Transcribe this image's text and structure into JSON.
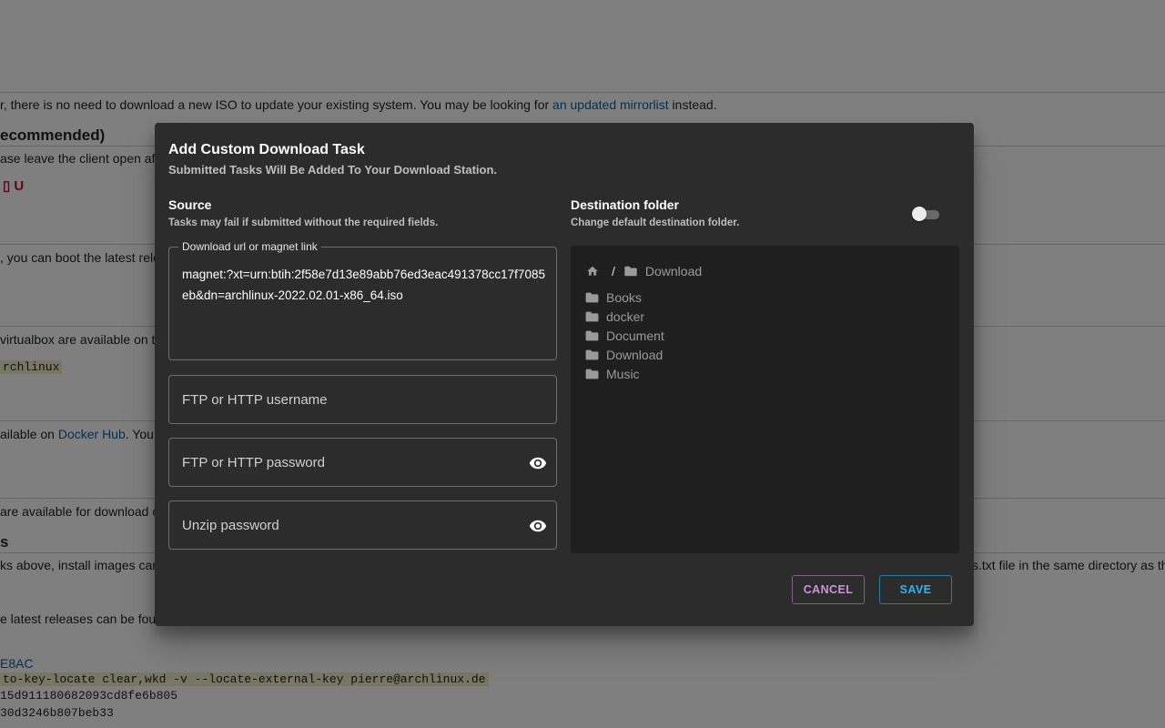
{
  "background": {
    "line1_text": "r, there is no need to download a new ISO to update your existing system. You may be looking for ",
    "line1_link": "an updated mirrorlist",
    "line1_tail": " instead.",
    "heading1": "ecommended)",
    "line2": "ase leave the client open after",
    "line3": ", you can boot the latest relea",
    "line4": "virtualbox are available on the",
    "code1": "rchlinux",
    "line5_text": "ailable on ",
    "line5_link": "Docker Hub",
    "line5_tail": ". You c",
    "line6": " are available for download or",
    "heading2": "s",
    "line7": "ks above, install images can a",
    "line7_right": "s.txt file in the same directory as the",
    "line8": "e latest releases can be found",
    "link_key": "E8AC",
    "code2": "to-key-locate clear,wkd -v --locate-external-key pierre@archlinux.de",
    "mono1": "15d911180682093cd8fe6b805",
    "mono2": "30d3246b807beb33"
  },
  "dialog": {
    "title": "Add Custom Download Task",
    "subtitle": "Submitted Tasks Will Be Added To Your Download Station.",
    "source": {
      "title": "Source",
      "subtitle": "Tasks may fail if submitted without the required fields.",
      "url_label": "Download url or magnet link",
      "url_value": "magnet:?xt=urn:btih:2f58e7d13e89abb76ed3eac491378cc17f7085eb&dn=archlinux-2022.02.01-x86_64.iso",
      "username_placeholder": "FTP or HTTP username",
      "password_placeholder": "FTP or HTTP password",
      "unzip_placeholder": "Unzip password"
    },
    "destination": {
      "title": "Destination folder",
      "subtitle": "Change default destination folder.",
      "toggle_on": false,
      "breadcrumb_sep": "/",
      "current_folder": "Download",
      "folders": [
        "Books",
        "docker",
        "Document",
        "Download",
        "Music"
      ]
    },
    "buttons": {
      "cancel": "CANCEL",
      "save": "SAVE"
    }
  },
  "colors": {
    "dialog_bg": "#2c2c2c",
    "cancel": "#ce93d8",
    "save": "#29b6f6"
  }
}
